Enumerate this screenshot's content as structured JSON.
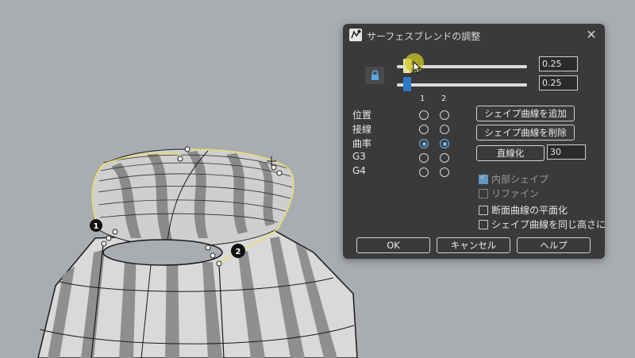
{
  "dialog": {
    "title": "サーフェスブレンドの調整",
    "slider1_value": "0.25",
    "slider2_value": "0.25",
    "col1": "1",
    "col2": "2",
    "rows": [
      {
        "label": "位置",
        "sel1": false,
        "sel2": false
      },
      {
        "label": "接線",
        "sel1": false,
        "sel2": false
      },
      {
        "label": "曲率",
        "sel1": true,
        "sel2": true
      },
      {
        "label": "G3",
        "sel1": false,
        "sel2": false
      },
      {
        "label": "G4",
        "sel1": false,
        "sel2": false
      }
    ],
    "add_shape_curve": "シェイプ曲線を追加",
    "remove_shape_curve": "シェイプ曲線を削除",
    "straighten": "直線化",
    "straighten_value": "30",
    "chk_inner_shape": {
      "label": "内部シェイプ",
      "checked": true
    },
    "chk_refine": {
      "label": "リファイン",
      "checked": false
    },
    "chk_planar": {
      "label": "断面曲線の平面化",
      "checked": false
    },
    "chk_same_height": {
      "label": "シェイプ曲線を同じ高さに",
      "checked": false
    },
    "ok": "OK",
    "cancel": "キャンセル",
    "help": "ヘルプ"
  },
  "viewport": {
    "marker1": "1",
    "marker2": "2"
  },
  "colors": {
    "viewport_bg": "#a9acb1",
    "dialog_bg": "#3a3a3a",
    "accent": "#6fb6ee",
    "slider1_thumb": "#e8e4a0",
    "slider2_thumb": "#2f78c4",
    "blend_edge": "#e8e06a"
  }
}
